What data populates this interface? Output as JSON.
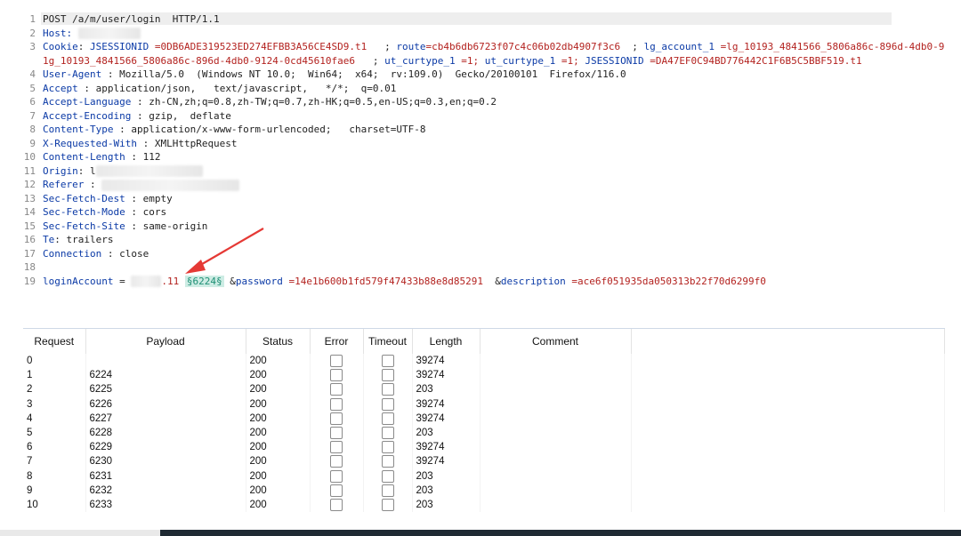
{
  "request": {
    "lines": [
      {
        "n": "1",
        "parts": [
          {
            "t": "POST /a/m/user/login  HTTP/1.1",
            "c": "p"
          }
        ]
      },
      {
        "n": "2",
        "parts": [
          {
            "t": "Host:",
            "c": "k"
          },
          {
            "t": " ",
            "c": "p"
          },
          {
            "blur": 70
          }
        ]
      },
      {
        "n": "3",
        "parts": [
          {
            "t": "Cookie",
            "c": "k"
          },
          {
            "t": ": ",
            "c": "p"
          },
          {
            "t": "JSESSIONID",
            "c": "k"
          },
          {
            "t": " =0DB6ADE319523ED274EFBB3A56CE4SD9.t1  ",
            "c": "r"
          },
          {
            "t": " ; ",
            "c": "p"
          },
          {
            "t": "route",
            "c": "k"
          },
          {
            "t": "=cb4b6db6723f07c4c06b02db4907f3c6",
            "c": "r"
          },
          {
            "t": "  ; ",
            "c": "p"
          },
          {
            "t": "lg_account_1",
            "c": "k"
          },
          {
            "t": " =lg_10193_4841566_5806a86c-896d-4db0-9",
            "c": "r"
          }
        ]
      },
      {
        "n": "",
        "parts": [
          {
            "t": "1g_10193_4841566_5806a86c-896d-4db0-9124-0cd45610fae6",
            "c": "r"
          },
          {
            "t": "   ; ",
            "c": "p"
          },
          {
            "t": "ut_curtype_1",
            "c": "k"
          },
          {
            "t": " =1;",
            "c": "r"
          },
          {
            "t": " ",
            "c": "p"
          },
          {
            "t": "ut_curtype_1",
            "c": "k"
          },
          {
            "t": " =1;",
            "c": "r"
          },
          {
            "t": " ",
            "c": "p"
          },
          {
            "t": "JSESSIONID",
            "c": "k"
          },
          {
            "t": " =DA47EF0C94BD776442C1F6B5C5BBF519.t1",
            "c": "r"
          }
        ]
      },
      {
        "n": "4",
        "parts": [
          {
            "t": "User-Agent",
            "c": "k"
          },
          {
            "t": " : Mozilla/5.0  (Windows NT 10.0;  Win64;  x64;  rv:109.0)  Gecko/20100101  Firefox/116.0",
            "c": "p"
          }
        ]
      },
      {
        "n": "5",
        "parts": [
          {
            "t": "Accept",
            "c": "k"
          },
          {
            "t": " : application/json,   text/javascript,   */*;  q=0.01",
            "c": "p"
          }
        ]
      },
      {
        "n": "6",
        "parts": [
          {
            "t": "Accept-Language",
            "c": "k"
          },
          {
            "t": " : zh-CN,zh;q=0.8,zh-TW;q=0.7,zh-HK;q=0.5,en-US;q=0.3,en;q=0.2",
            "c": "p"
          }
        ]
      },
      {
        "n": "7",
        "parts": [
          {
            "t": "Accept-Encoding",
            "c": "k"
          },
          {
            "t": " : gzip,  deflate",
            "c": "p"
          }
        ]
      },
      {
        "n": "8",
        "parts": [
          {
            "t": "Content-Type",
            "c": "k"
          },
          {
            "t": " : application/x-www-form-urlencoded;   charset=UTF-8",
            "c": "p"
          }
        ]
      },
      {
        "n": "9",
        "parts": [
          {
            "t": "X-Requested-With",
            "c": "k"
          },
          {
            "t": " : XMLHttpRequest",
            "c": "p"
          }
        ]
      },
      {
        "n": "10",
        "parts": [
          {
            "t": "Content-Length",
            "c": "k"
          },
          {
            "t": " : 112",
            "c": "p"
          }
        ]
      },
      {
        "n": "11",
        "parts": [
          {
            "t": "Origin",
            "c": "k"
          },
          {
            "t": ": ",
            "c": "p"
          },
          {
            "t": "l",
            "c": "p"
          },
          {
            "blur": 120
          }
        ]
      },
      {
        "n": "12",
        "parts": [
          {
            "t": "Referer",
            "c": "k"
          },
          {
            "t": " : ",
            "c": "p"
          },
          {
            "blur": 155
          }
        ]
      },
      {
        "n": "13",
        "parts": [
          {
            "t": "Sec-Fetch-Dest",
            "c": "k"
          },
          {
            "t": " : empty",
            "c": "p"
          }
        ]
      },
      {
        "n": "14",
        "parts": [
          {
            "t": "Sec-Fetch-Mode",
            "c": "k"
          },
          {
            "t": " : cors",
            "c": "p"
          }
        ]
      },
      {
        "n": "15",
        "parts": [
          {
            "t": "Sec-Fetch-Site",
            "c": "k"
          },
          {
            "t": " : same-origin",
            "c": "p"
          }
        ]
      },
      {
        "n": "16",
        "parts": [
          {
            "t": "Te",
            "c": "k"
          },
          {
            "t": ": trailers",
            "c": "p"
          }
        ]
      },
      {
        "n": "17",
        "parts": [
          {
            "t": "Connection",
            "c": "k"
          },
          {
            "t": " : close",
            "c": "p"
          }
        ]
      },
      {
        "n": "18",
        "parts": []
      },
      {
        "n": "19",
        "parts": [
          {
            "t": "loginAccount",
            "c": "k"
          },
          {
            "t": " = ",
            "c": "p"
          },
          {
            "blur": 34
          },
          {
            "t": ".11 ",
            "c": "r"
          },
          {
            "t": "§6224§",
            "c": "mark"
          },
          {
            "t": " &",
            "c": "p"
          },
          {
            "t": "password",
            "c": "k"
          },
          {
            "t": " =14e1b600b1fd579f47433b88e8d85291",
            "c": "r"
          },
          {
            "t": "  &",
            "c": "p"
          },
          {
            "t": "description",
            "c": "k"
          },
          {
            "t": " =ace6f051935da050313b22f70d6299f0",
            "c": "r"
          }
        ]
      }
    ]
  },
  "results": {
    "columns": [
      "Request",
      "Payload",
      "Status",
      "Error",
      "Timeout",
      "Length",
      "Comment"
    ],
    "rows": [
      {
        "request": "0",
        "payload": "",
        "status": "200",
        "length": "39274"
      },
      {
        "request": "1",
        "payload": "6224",
        "status": "200",
        "length": "39274"
      },
      {
        "request": "2",
        "payload": "6225",
        "status": "200",
        "length": "203"
      },
      {
        "request": "3",
        "payload": "6226",
        "status": "200",
        "length": "39274"
      },
      {
        "request": "4",
        "payload": "6227",
        "status": "200",
        "length": "39274"
      },
      {
        "request": "5",
        "payload": "6228",
        "status": "200",
        "length": "203"
      },
      {
        "request": "6",
        "payload": "6229",
        "status": "200",
        "length": "39274"
      },
      {
        "request": "7",
        "payload": "6230",
        "status": "200",
        "length": "39274"
      },
      {
        "request": "8",
        "payload": "6231",
        "status": "200",
        "length": "203"
      },
      {
        "request": "9",
        "payload": "6232",
        "status": "200",
        "length": "203"
      },
      {
        "request": "10",
        "payload": "6233",
        "status": "200",
        "length": "203"
      }
    ]
  },
  "colors": {
    "key": "#0b3aa6",
    "value": "#b3221f",
    "payload_marker": "#1e8f74",
    "arrow": "#e53935"
  }
}
